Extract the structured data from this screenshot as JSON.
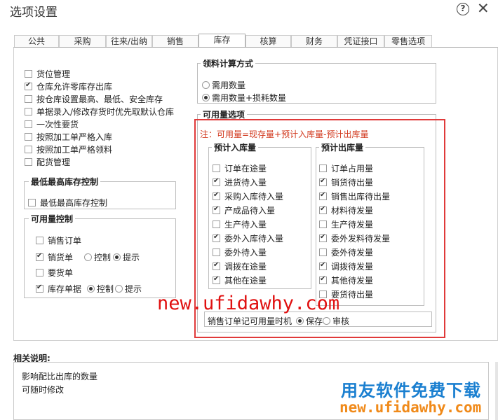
{
  "window": {
    "title": "选项设置"
  },
  "tabs": [
    "公共",
    "采购",
    "往来/出纳",
    "销售",
    "库存",
    "核算",
    "财务",
    "凭证接口",
    "零售选项"
  ],
  "left_options": [
    {
      "label": "货位管理",
      "checked": false
    },
    {
      "label": "仓库允许零库存出库",
      "checked": true
    },
    {
      "label": "按仓库设置最高、最低、安全库存",
      "checked": false
    },
    {
      "label": "单据录入/修改存货时优先取默认仓库",
      "checked": false
    },
    {
      "label": "一次性要货",
      "checked": false
    },
    {
      "label": "按照加工单严格入库",
      "checked": false
    },
    {
      "label": "按照加工单严格领料",
      "checked": false
    },
    {
      "label": "配货管理",
      "checked": false
    }
  ],
  "max_min": {
    "title": "最低最高库存控制",
    "option": "最低最高库存控制",
    "checked": false
  },
  "avail_control": {
    "title": "可用量控制",
    "sales_order": "销售订单",
    "sales_bill": "销货单",
    "request_bill": "要货单",
    "stock_bill": "库存单据",
    "control": "控制",
    "prompt": "提示"
  },
  "pick_method": {
    "title": "领料计算方式",
    "options": [
      "需用数量",
      "需用数量+损耗数量"
    ],
    "selected": 1
  },
  "avail_options": {
    "title": "可用量选项",
    "note": "注：可用量=现存量+预计入库量-预计出库量",
    "in_title": "预计入库量",
    "in_items": [
      {
        "label": "订单在途量",
        "checked": false
      },
      {
        "label": "进货待入量",
        "checked": true
      },
      {
        "label": "采购入库待入量",
        "checked": true
      },
      {
        "label": "产成品待入量",
        "checked": true
      },
      {
        "label": "生产待入量",
        "checked": false
      },
      {
        "label": "委外入库待入量",
        "checked": true
      },
      {
        "label": "委外待入量",
        "checked": false
      },
      {
        "label": "调拨在途量",
        "checked": true
      },
      {
        "label": "其他在途量",
        "checked": true
      }
    ],
    "out_title": "预计出库量",
    "out_items": [
      {
        "label": "订单占用量",
        "checked": false
      },
      {
        "label": "销货待出量",
        "checked": true
      },
      {
        "label": "销售出库待出量",
        "checked": true
      },
      {
        "label": "材料待发量",
        "checked": true
      },
      {
        "label": "生产待发量",
        "checked": false
      },
      {
        "label": "委外发料待发量",
        "checked": true
      },
      {
        "label": "委外待发量",
        "checked": false
      },
      {
        "label": "调拨待发量",
        "checked": true
      },
      {
        "label": "其他待发量",
        "checked": true
      },
      {
        "label": "要货待出量",
        "checked": false
      }
    ],
    "timing_label": "销售订单记可用量时机",
    "timing_save": "保存",
    "timing_audit": "审核"
  },
  "description": {
    "title": "相关说明:",
    "lines": [
      "影响配比出库的数量",
      "可随时修改"
    ]
  },
  "watermarks": {
    "url": "new.ufidawhy.com",
    "brand": "用友软件免费下载",
    "url2": "new.ufidawhy.com"
  }
}
